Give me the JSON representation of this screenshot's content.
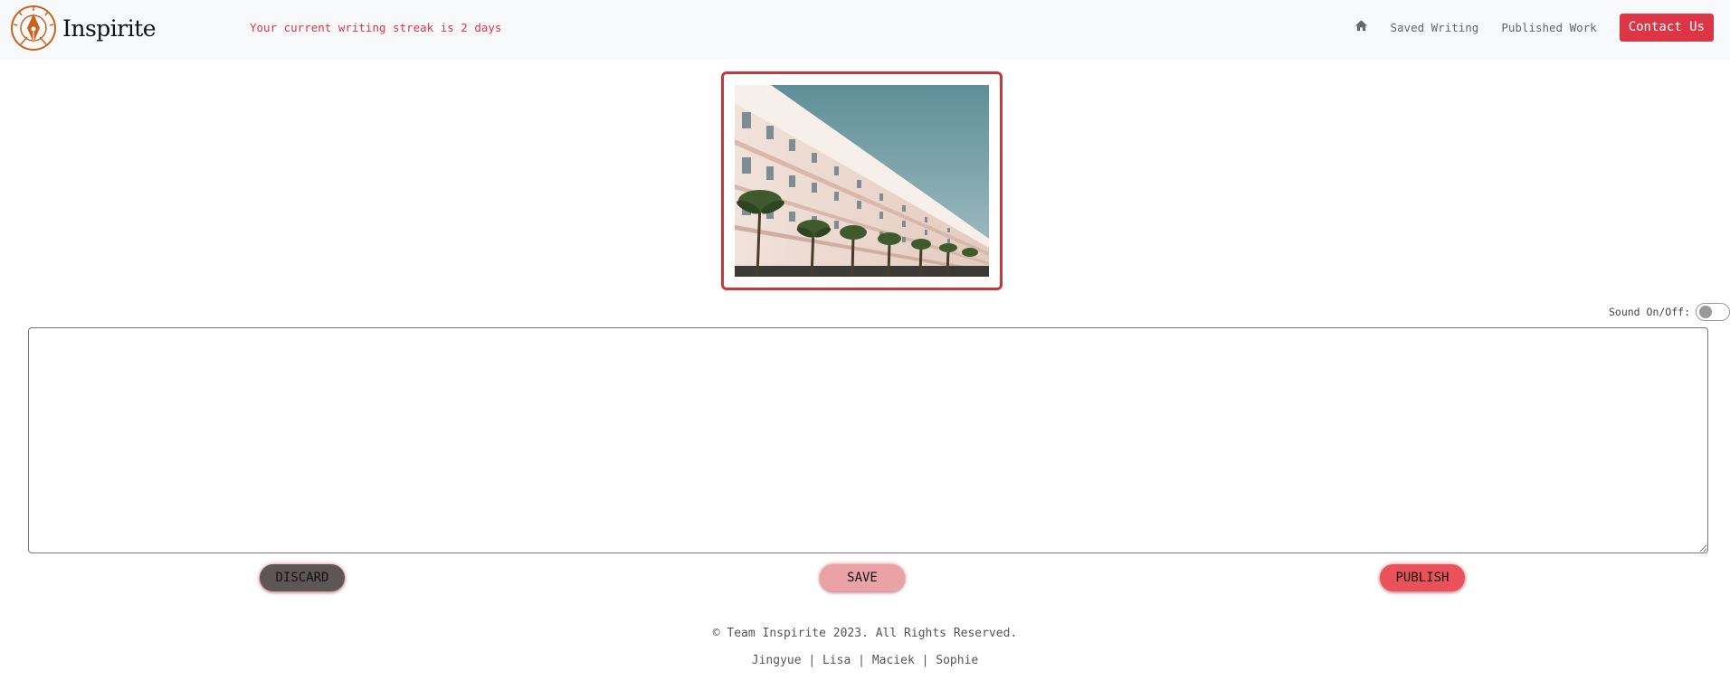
{
  "brand": {
    "name": "Inspirite"
  },
  "streak": {
    "text": "Your current writing streak is 2 days"
  },
  "nav": {
    "home_icon": "home-icon",
    "saved_writing": "Saved Writing",
    "published_work": "Published Work",
    "contact_us": "Contact Us"
  },
  "prompt_image": {
    "alt": "Pink building with palm trees"
  },
  "sound": {
    "label": "Sound On/Off:",
    "enabled": false
  },
  "editor": {
    "value": "",
    "placeholder": ""
  },
  "actions": {
    "discard": "DISCARD",
    "save": "SAVE",
    "publish": "PUBLISH"
  },
  "footer": {
    "copyright": "© Team Inspirite 2023. All Rights Reserved.",
    "team": "Jingyue | Lisa | Maciek | Sophie"
  },
  "colors": {
    "accent": "#dc3545",
    "frame": "#c0393b",
    "navbar_bg": "#f8f9fa",
    "logo": "#c8641e"
  }
}
